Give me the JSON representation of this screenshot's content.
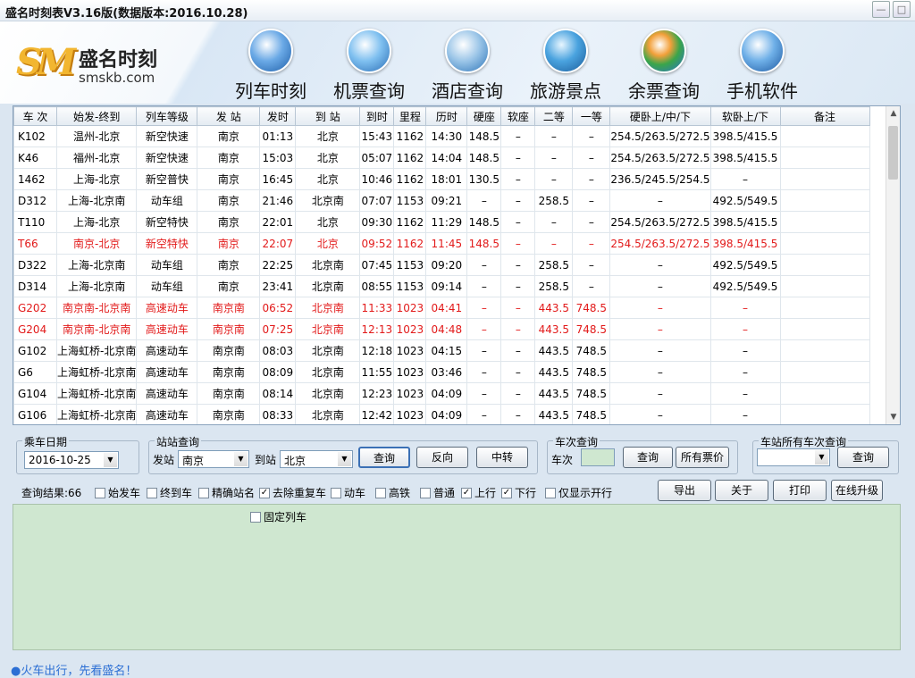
{
  "title": "盛名时刻表V3.16版(数据版本:2016.10.28)",
  "window_buttons": {
    "minimize": "—",
    "close": "□"
  },
  "logo": {
    "mark": "SM",
    "name": "盛名时刻",
    "site": "smskb.com"
  },
  "colors": {
    "accent": "#3b70b5",
    "red_row": "#e21a1a",
    "result_bg": "#cfe7d0"
  },
  "nav": [
    {
      "label": "列车时刻",
      "icon": "train-icon"
    },
    {
      "label": "机票查询",
      "icon": "plane-icon"
    },
    {
      "label": "酒店查询",
      "icon": "hotel-icon"
    },
    {
      "label": "旅游景点",
      "icon": "globe-icon"
    },
    {
      "label": "余票查询",
      "icon": "windows-icon"
    },
    {
      "label": "手机软件",
      "icon": "java-icon"
    }
  ],
  "table": {
    "headers": [
      "车 次",
      "始发-终到",
      "列车等级",
      "发 站",
      "发时",
      "到 站",
      "到时",
      "里程",
      "历时",
      "硬座",
      "软座",
      "二等",
      "一等",
      "硬卧上/中/下",
      "软卧上/下",
      "备注"
    ],
    "rows": [
      {
        "cells": [
          "K102",
          "温州-北京",
          "新空快速",
          "南京",
          "01:13",
          "北京",
          "15:43",
          "1162",
          "14:30",
          "148.5",
          "–",
          "–",
          "–",
          "254.5/263.5/272.5",
          "398.5/415.5",
          ""
        ],
        "red": false
      },
      {
        "cells": [
          "K46",
          "福州-北京",
          "新空快速",
          "南京",
          "15:03",
          "北京",
          "05:07",
          "1162",
          "14:04",
          "148.5",
          "–",
          "–",
          "–",
          "254.5/263.5/272.5",
          "398.5/415.5",
          ""
        ],
        "red": false
      },
      {
        "cells": [
          "1462",
          "上海-北京",
          "新空普快",
          "南京",
          "16:45",
          "北京",
          "10:46",
          "1162",
          "18:01",
          "130.5",
          "–",
          "–",
          "–",
          "236.5/245.5/254.5",
          "–",
          ""
        ],
        "red": false
      },
      {
        "cells": [
          "D312",
          "上海-北京南",
          "动车组",
          "南京",
          "21:46",
          "北京南",
          "07:07",
          "1153",
          "09:21",
          "–",
          "–",
          "258.5",
          "–",
          "–",
          "492.5/549.5",
          ""
        ],
        "red": false
      },
      {
        "cells": [
          "T110",
          "上海-北京",
          "新空特快",
          "南京",
          "22:01",
          "北京",
          "09:30",
          "1162",
          "11:29",
          "148.5",
          "–",
          "–",
          "–",
          "254.5/263.5/272.5",
          "398.5/415.5",
          ""
        ],
        "red": false
      },
      {
        "cells": [
          "T66",
          "南京-北京",
          "新空特快",
          "南京",
          "22:07",
          "北京",
          "09:52",
          "1162",
          "11:45",
          "148.5",
          "–",
          "–",
          "–",
          "254.5/263.5/272.5",
          "398.5/415.5",
          ""
        ],
        "red": true
      },
      {
        "cells": [
          "D322",
          "上海-北京南",
          "动车组",
          "南京",
          "22:25",
          "北京南",
          "07:45",
          "1153",
          "09:20",
          "–",
          "–",
          "258.5",
          "–",
          "–",
          "492.5/549.5",
          ""
        ],
        "red": false
      },
      {
        "cells": [
          "D314",
          "上海-北京南",
          "动车组",
          "南京",
          "23:41",
          "北京南",
          "08:55",
          "1153",
          "09:14",
          "–",
          "–",
          "258.5",
          "–",
          "–",
          "492.5/549.5",
          ""
        ],
        "red": false
      },
      {
        "cells": [
          "G202",
          "南京南-北京南",
          "高速动车",
          "南京南",
          "06:52",
          "北京南",
          "11:33",
          "1023",
          "04:41",
          "–",
          "–",
          "443.5",
          "748.5",
          "–",
          "–",
          ""
        ],
        "red": true
      },
      {
        "cells": [
          "G204",
          "南京南-北京南",
          "高速动车",
          "南京南",
          "07:25",
          "北京南",
          "12:13",
          "1023",
          "04:48",
          "–",
          "–",
          "443.5",
          "748.5",
          "–",
          "–",
          ""
        ],
        "red": true
      },
      {
        "cells": [
          "G102",
          "上海虹桥-北京南",
          "高速动车",
          "南京南",
          "08:03",
          "北京南",
          "12:18",
          "1023",
          "04:15",
          "–",
          "–",
          "443.5",
          "748.5",
          "–",
          "–",
          ""
        ],
        "red": false
      },
      {
        "cells": [
          "G6",
          "上海虹桥-北京南",
          "高速动车",
          "南京南",
          "08:09",
          "北京南",
          "11:55",
          "1023",
          "03:46",
          "–",
          "–",
          "443.5",
          "748.5",
          "–",
          "–",
          ""
        ],
        "red": false
      },
      {
        "cells": [
          "G104",
          "上海虹桥-北京南",
          "高速动车",
          "南京南",
          "08:14",
          "北京南",
          "12:23",
          "1023",
          "04:09",
          "–",
          "–",
          "443.5",
          "748.5",
          "–",
          "–",
          ""
        ],
        "red": false
      },
      {
        "cells": [
          "G106",
          "上海虹桥-北京南",
          "高速动车",
          "南京南",
          "08:33",
          "北京南",
          "12:42",
          "1023",
          "04:09",
          "–",
          "–",
          "443.5",
          "748.5",
          "–",
          "–",
          ""
        ],
        "red": false
      }
    ]
  },
  "date_group": {
    "caption": "乘车日期",
    "value": "2016-10-25"
  },
  "station_group": {
    "caption": "站站查询",
    "from_label": "发站",
    "from_value": "南京",
    "to_label": "到站",
    "to_value": "北京",
    "query": "查询",
    "reverse": "反向",
    "transfer": "中转"
  },
  "train_group": {
    "caption": "车次查询",
    "label": "车次",
    "value": "",
    "query": "查询",
    "prices": "所有票价"
  },
  "allstation_group": {
    "caption": "车站所有车次查询",
    "value": "",
    "query": "查询"
  },
  "result_count": "查询结果:66",
  "filters": [
    {
      "label": "始发车",
      "checked": false
    },
    {
      "label": "终到车",
      "checked": false
    },
    {
      "label": "精确站名",
      "checked": false
    },
    {
      "label": "去除重复车",
      "checked": true
    },
    {
      "label": "动车",
      "checked": false
    },
    {
      "label": "高铁",
      "checked": false
    },
    {
      "label": "普通",
      "checked": false
    },
    {
      "label": "上行",
      "checked": true
    },
    {
      "label": "下行",
      "checked": true
    },
    {
      "label": "仅显示开行",
      "checked": false
    }
  ],
  "actions": {
    "export": "导出",
    "about": "关于",
    "print": "打印",
    "upgrade": "在线升级"
  },
  "fixed_train": {
    "label": "固定列车",
    "checked": false
  },
  "footer": "●火车出行，先看盛名！"
}
